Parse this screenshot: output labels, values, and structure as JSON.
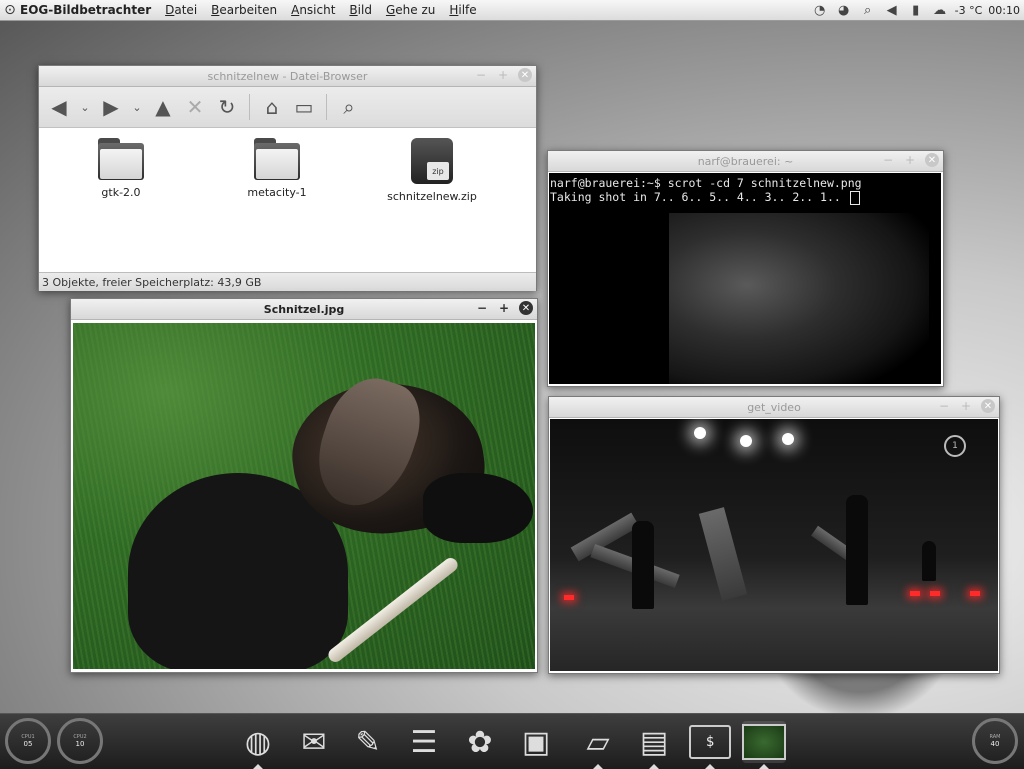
{
  "top_panel": {
    "app_name": "EOG-Bildbetrachter",
    "menus": [
      {
        "key": "D",
        "rest": "atei"
      },
      {
        "key": "B",
        "rest": "earbeiten"
      },
      {
        "key": "A",
        "rest": "nsicht"
      },
      {
        "key": "B",
        "rest": "ild"
      },
      {
        "key": "G",
        "rest": "ehe zu"
      },
      {
        "key": "H",
        "rest": "ilfe"
      }
    ],
    "tray": {
      "temperature": "-3 °C",
      "clock": "00:10"
    }
  },
  "file_browser": {
    "title": "schnitzelnew - Datei-Browser",
    "files": [
      {
        "name": "gtk-2.0",
        "type": "folder"
      },
      {
        "name": "metacity-1",
        "type": "folder"
      },
      {
        "name": "schnitzelnew.zip",
        "type": "zip"
      }
    ],
    "zip_label": "zip",
    "status": "3 Objekte, freier Speicherplatz: 43,9 GB"
  },
  "image_viewer": {
    "title": "Schnitzel.jpg"
  },
  "terminal": {
    "title": "narf@brauerei: ~",
    "line1": "narf@brauerei:~$ scrot -cd 7 schnitzelnew.png",
    "line2": "Taking shot in 7.. 6.. 5.. 4.. 3.. 2.. 1.. "
  },
  "video": {
    "title": "get_video",
    "channel_logo": "1"
  },
  "dock": {
    "gauges": [
      {
        "label": "CPU1",
        "value": "05"
      },
      {
        "label": "CPU2",
        "value": "10"
      },
      {
        "label": "RAM",
        "value": "40"
      }
    ],
    "terminal_icon_text": "$"
  }
}
